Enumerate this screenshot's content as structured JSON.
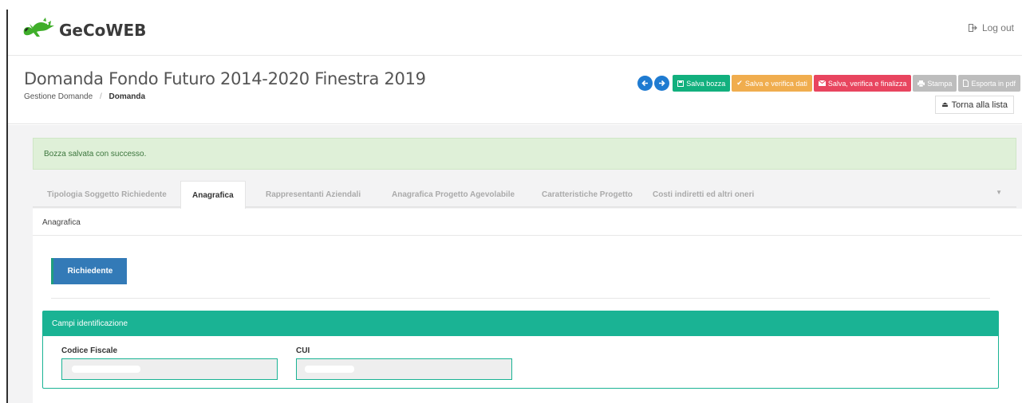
{
  "app": {
    "name": "GeCoWEB",
    "logout_label": "Log out"
  },
  "page": {
    "title": "Domanda Fondo Futuro 2014-2020 Finestra 2019",
    "breadcrumb": [
      "Gestione Domande",
      "Domanda"
    ]
  },
  "toolbar": {
    "prev_icon": "arrow-left-icon",
    "next_icon": "arrow-right-icon",
    "save_draft": "Salva bozza",
    "save_verify": "Salva e verifica dati",
    "save_finalize": "Salva, verifica e finalizza",
    "print": "Stampa",
    "export_pdf": "Esporta in pdf",
    "back_to_list": "Torna alla lista"
  },
  "alert": {
    "message": "Bozza salvata con successo."
  },
  "tabs": [
    {
      "label": "Tipologia Soggetto Richiedente",
      "active": false
    },
    {
      "label": "Anagrafica",
      "active": true
    },
    {
      "label": "Rappresentanti Aziendali",
      "active": false
    },
    {
      "label": "Anagrafica Progetto Agevolabile",
      "active": false
    },
    {
      "label": "Caratteristiche Progetto",
      "active": false
    },
    {
      "label": "Costi indiretti ed altri oneri",
      "active": false
    }
  ],
  "panel": {
    "heading": "Anagrafica",
    "richiedente_button": "Richiedente",
    "card_title": "Campi identificazione",
    "fields": [
      {
        "label": "Codice Fiscale",
        "value": ""
      },
      {
        "label": "CUI",
        "value": ""
      }
    ]
  },
  "colors": {
    "primary": "#337ab7",
    "teal": "#1ab394",
    "success_green": "#12b07e",
    "warning_orange": "#f0ad4e",
    "danger_red": "#e8455f",
    "disabled_gray": "#bdbdbd",
    "alert_bg": "#dff0d8"
  }
}
